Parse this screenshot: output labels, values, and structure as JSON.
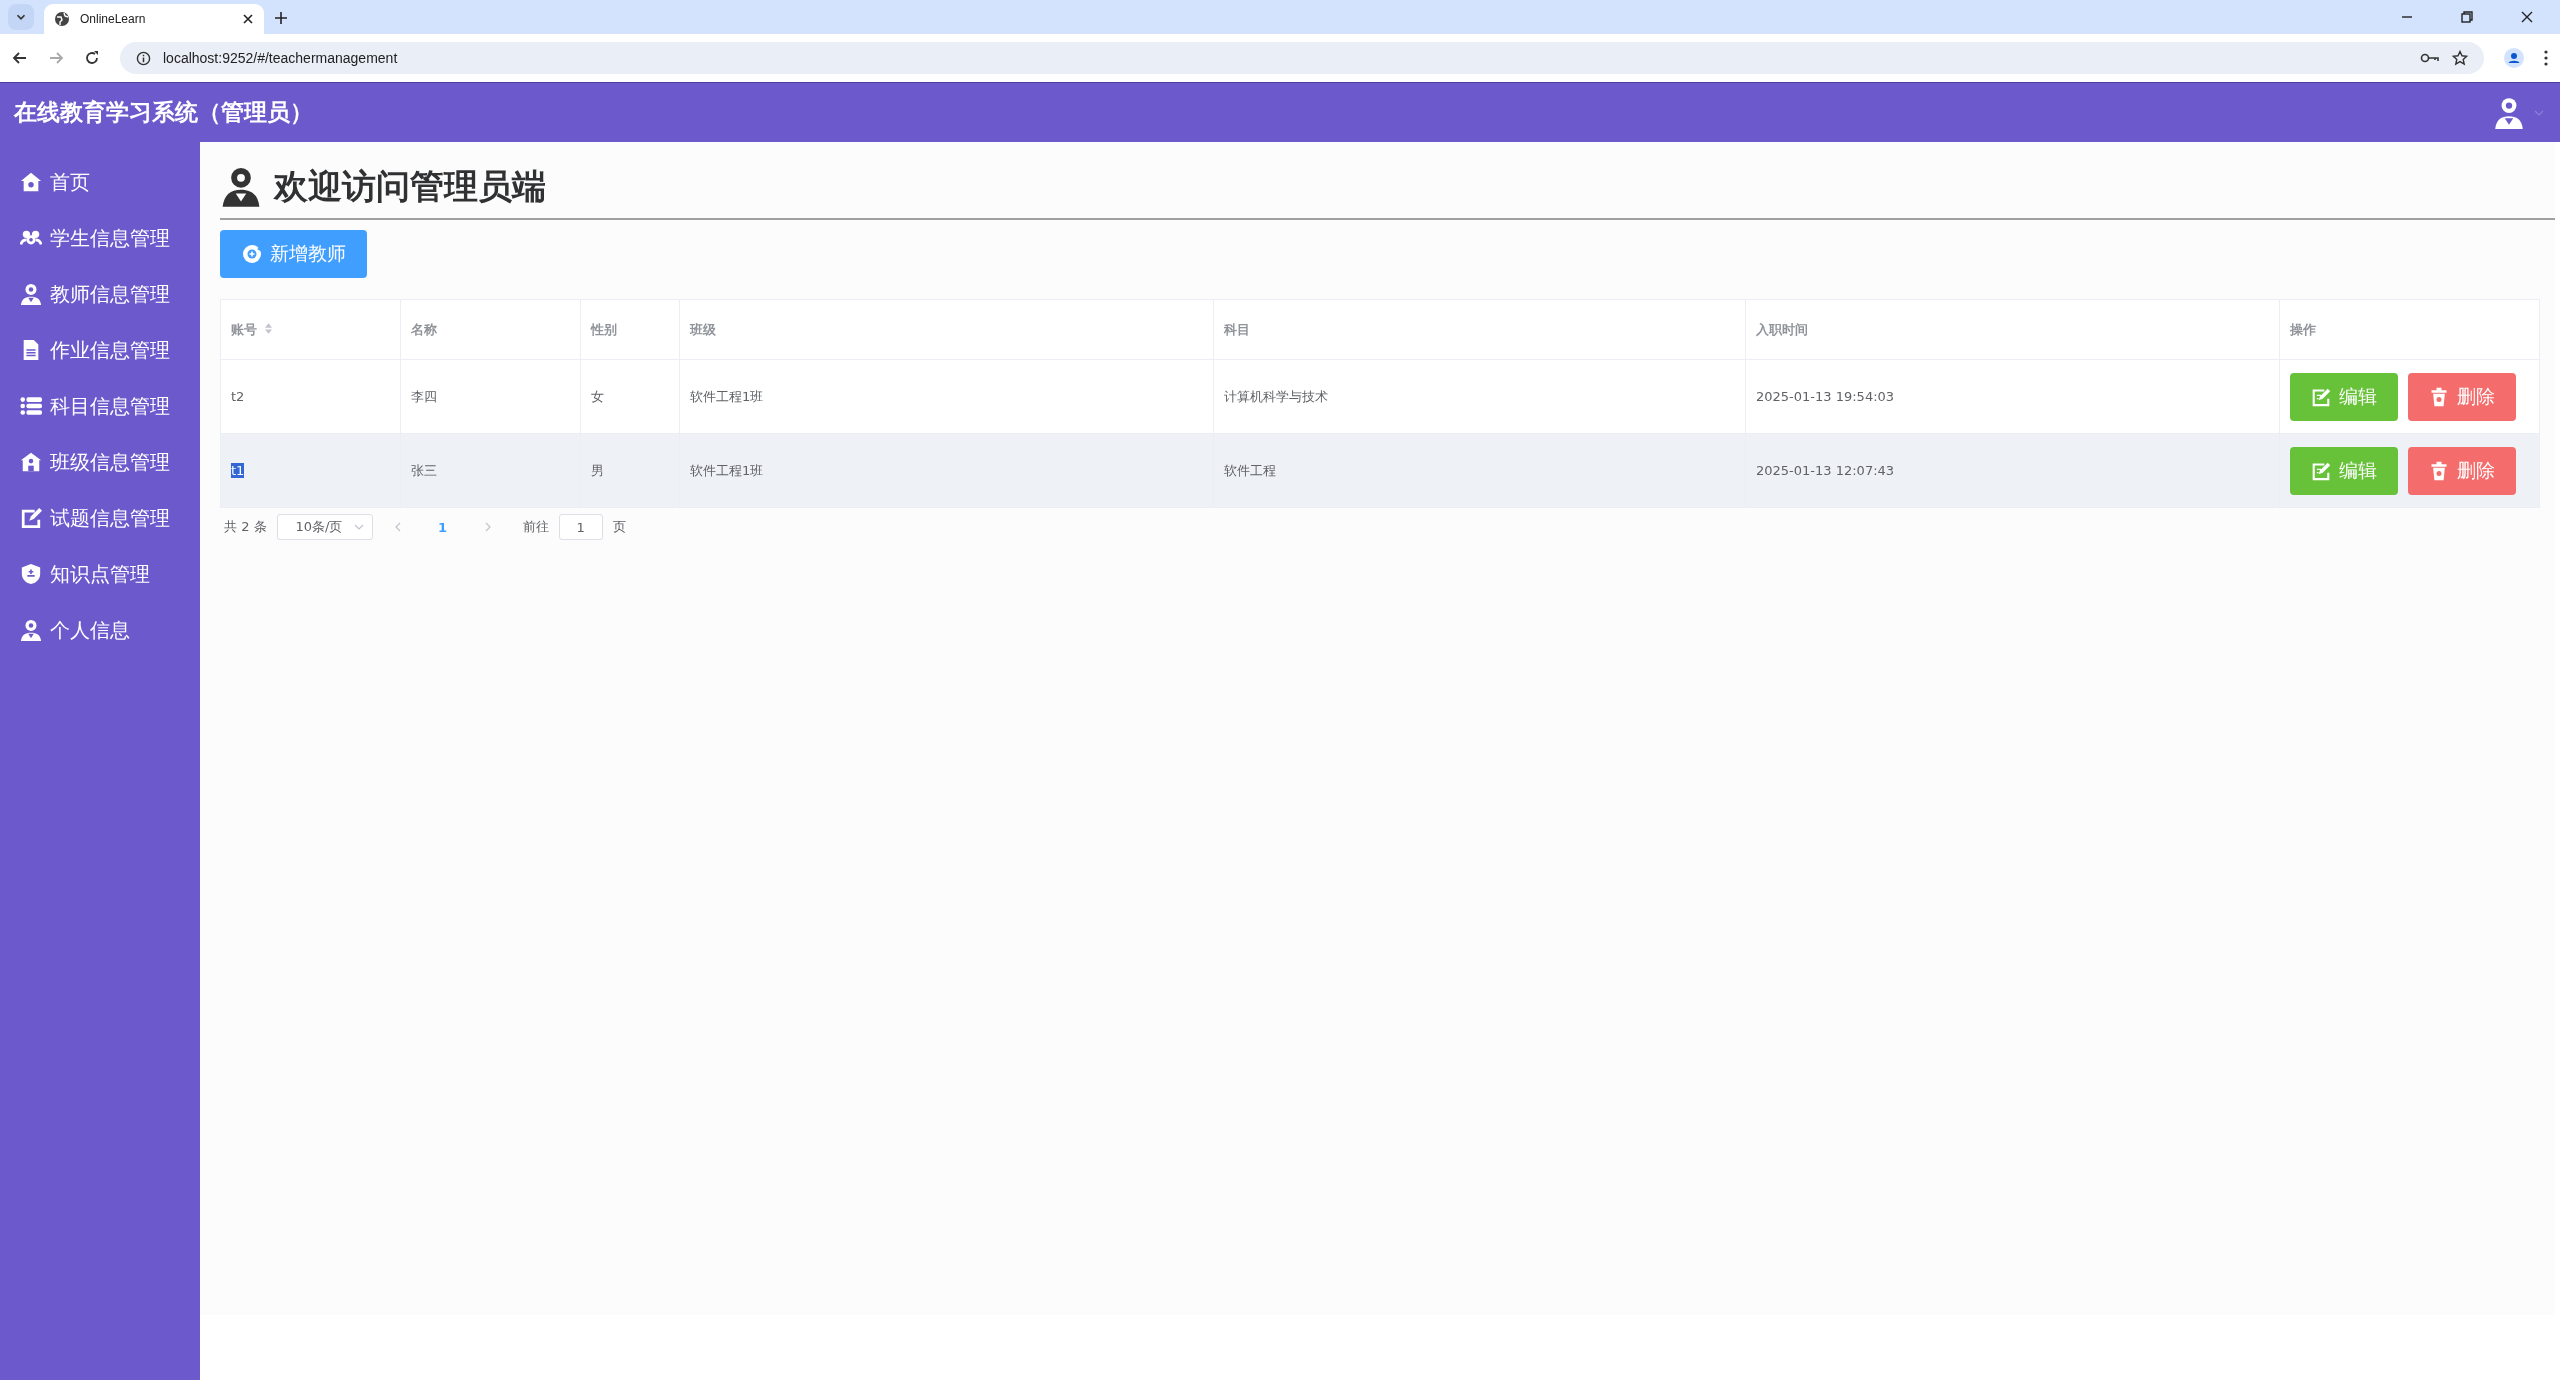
{
  "browser": {
    "tab_title": "OnlineLearn",
    "url": "localhost:9252/#/teachermanagement"
  },
  "header": {
    "title": "在线教育学习系统（管理员）"
  },
  "sidebar": {
    "items": [
      {
        "label": "首页"
      },
      {
        "label": "学生信息管理"
      },
      {
        "label": "教师信息管理"
      },
      {
        "label": "作业信息管理"
      },
      {
        "label": "科目信息管理"
      },
      {
        "label": "班级信息管理"
      },
      {
        "label": "试题信息管理"
      },
      {
        "label": "知识点管理"
      },
      {
        "label": "个人信息"
      }
    ]
  },
  "page": {
    "heading": "欢迎访问管理员端",
    "add_button": "新增教师"
  },
  "table": {
    "columns": [
      {
        "label": "账号",
        "sortable": true
      },
      {
        "label": "名称",
        "sortable": false
      },
      {
        "label": "性别",
        "sortable": false
      },
      {
        "label": "班级",
        "sortable": false
      },
      {
        "label": "科目",
        "sortable": false
      },
      {
        "label": "入职时间",
        "sortable": false
      },
      {
        "label": "操作",
        "sortable": false
      }
    ],
    "rows": [
      {
        "cells": [
          "t2",
          "李四",
          "女",
          "软件工程1班",
          "计算机科学与技术",
          "2025-01-13 19:54:03"
        ],
        "hovered": false,
        "account_text_selected": false,
        "actions": [
          {
            "kind": "edit",
            "label": "编辑"
          },
          {
            "kind": "delete",
            "label": "删除"
          }
        ]
      },
      {
        "cells": [
          "t1",
          "张三",
          "男",
          "软件工程1班",
          "软件工程",
          "2025-01-13 12:07:43"
        ],
        "hovered": true,
        "account_text_selected": true,
        "actions": [
          {
            "kind": "edit",
            "label": "编辑"
          },
          {
            "kind": "delete",
            "label": "删除"
          }
        ]
      }
    ]
  },
  "pagination": {
    "total": "共 2 条",
    "page_size": "10条/页",
    "pages": [
      {
        "label": "1",
        "selected": true
      }
    ],
    "goto_label": "前往",
    "goto_value": "1",
    "page_suffix": "页"
  }
}
